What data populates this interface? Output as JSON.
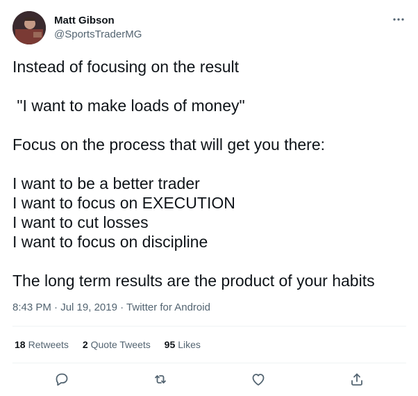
{
  "author": {
    "name": "Matt Gibson",
    "handle": "@SportsTraderMG"
  },
  "tweet": {
    "text": "Instead of focusing on the result\n\n \"I want to make loads of money\"\n\nFocus on the process that will get you there:\n\nI want to be a better trader\nI want to focus on EXECUTION\nI want to cut losses\nI want to focus on discipline\n\nThe long term results are the product of your habits",
    "time": "8:43 PM",
    "date": "Jul 19, 2019",
    "separator": "·",
    "source": "Twitter for Android"
  },
  "stats": {
    "retweets_count": "18",
    "retweets_label": "Retweets",
    "quotes_count": "2",
    "quotes_label": "Quote Tweets",
    "likes_count": "95",
    "likes_label": "Likes"
  },
  "icons": {
    "more": "more-icon",
    "reply": "reply-icon",
    "retweet": "retweet-icon",
    "like": "like-icon",
    "share": "share-icon"
  },
  "colors": {
    "text": "#0f1419",
    "secondary": "#536471",
    "divider": "#eff3f4"
  }
}
